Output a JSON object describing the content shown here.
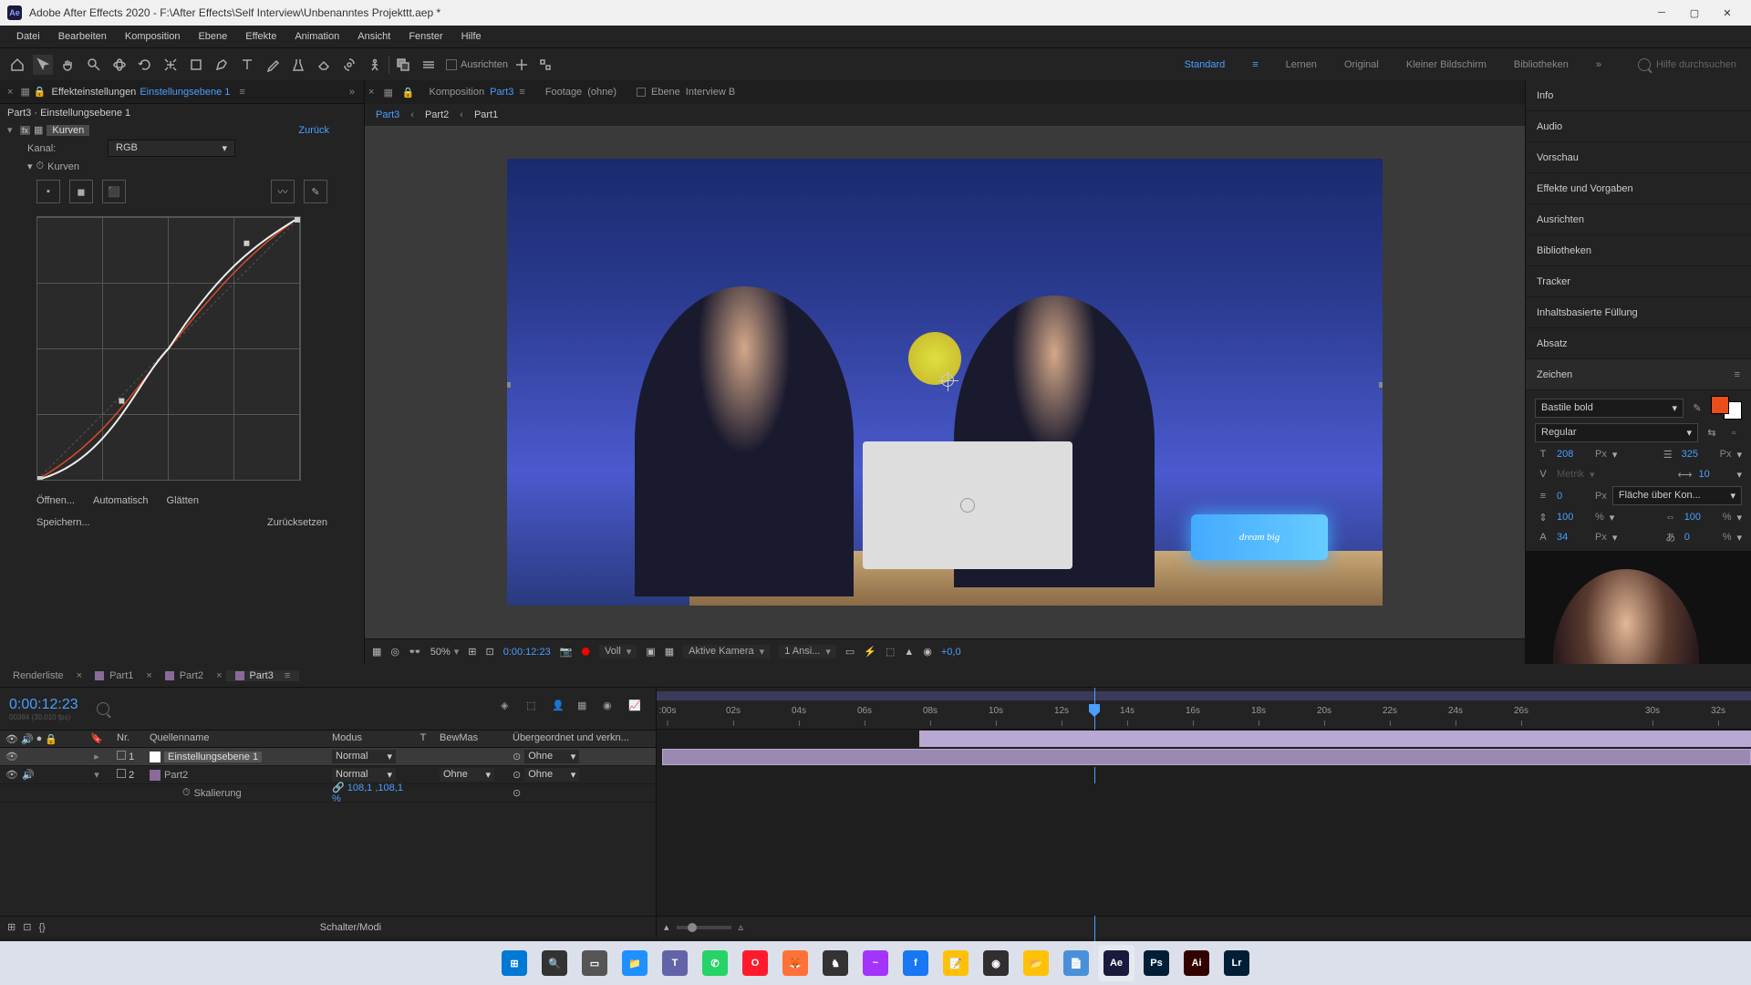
{
  "titlebar": {
    "app_badge": "Ae",
    "title": "Adobe After Effects 2020 - F:\\After Effects\\Self Interview\\Unbenanntes Projekttt.aep *"
  },
  "menu": [
    "Datei",
    "Bearbeiten",
    "Komposition",
    "Ebene",
    "Effekte",
    "Animation",
    "Ansicht",
    "Fenster",
    "Hilfe"
  ],
  "toolbar": {
    "align_label": "Ausrichten",
    "workspaces": [
      "Standard",
      "Lernen",
      "Original",
      "Kleiner Bildschirm",
      "Bibliotheken"
    ],
    "active_workspace": "Standard",
    "search_placeholder": "Hilfe durchsuchen"
  },
  "effect_controls": {
    "tab_label": "Effekteinstellungen",
    "tab_layer": "Einstellungsebene 1",
    "breadcrumb": "Part3 · Einstellungsebene 1",
    "effect_name": "Kurven",
    "reset": "Zurück",
    "channel_label": "Kanal:",
    "channel_value": "RGB",
    "curves_label": "Kurven",
    "btn_open": "Öffnen...",
    "btn_auto": "Automatisch",
    "btn_smooth": "Glätten",
    "btn_save": "Speichern...",
    "btn_reset2": "Zurücksetzen"
  },
  "composition": {
    "tab_comp": "Komposition",
    "comp_name": "Part3",
    "tab_footage": "Footage",
    "footage_val": "(ohne)",
    "tab_layer": "Ebene",
    "layer_val": "Interview B",
    "crumbs": [
      "Part3",
      "Part2",
      "Part1"
    ],
    "neon_text": "dream big"
  },
  "viewer_footer": {
    "zoom": "50%",
    "timecode": "0:00:12:23",
    "resolution": "Voll",
    "camera": "Aktive Kamera",
    "views": "1 Ansi...",
    "exposure": "+0,0"
  },
  "right_panels": {
    "info": "Info",
    "audio": "Audio",
    "preview": "Vorschau",
    "effects": "Effekte und Vorgaben",
    "align": "Ausrichten",
    "libraries": "Bibliotheken",
    "tracker": "Tracker",
    "content_fill": "Inhaltsbasierte Füllung",
    "paragraph": "Absatz",
    "character": "Zeichen"
  },
  "character": {
    "font": "Bastile bold",
    "style": "Regular",
    "size": "208",
    "size_unit": "Px",
    "leading": "325",
    "leading_unit": "Px",
    "kerning": "Metrik",
    "tracking": "10",
    "stroke_w": "0",
    "stroke_unit": "Px",
    "fill_label": "Fläche über Kon...",
    "vscale": "100",
    "vscale_unit": "%",
    "hscale": "100",
    "hscale_unit": "%",
    "baseline": "34",
    "baseline_unit": "Px",
    "tsume": "0",
    "tsume_unit": "%"
  },
  "timeline": {
    "tabs": [
      {
        "label": "Renderliste",
        "icon": false
      },
      {
        "label": "Part1",
        "icon": true
      },
      {
        "label": "Part2",
        "icon": true
      },
      {
        "label": "Part3",
        "icon": true,
        "active": true
      }
    ],
    "timecode": "0:00:12:23",
    "timecode_sub": "00384 (30.010 fps)",
    "columns": {
      "nr": "Nr.",
      "source": "Quellenname",
      "mode": "Modus",
      "t": "T",
      "trkmat": "BewMas",
      "parent": "Übergeordnet und verkn..."
    },
    "layers": [
      {
        "nr": "1",
        "name": "Einstellungsebene 1",
        "mode": "Normal",
        "track": "",
        "parent": "Ohne",
        "selected": true,
        "icon": "solid"
      },
      {
        "nr": "2",
        "name": "Part2",
        "mode": "Normal",
        "track": "Ohne",
        "parent": "Ohne",
        "selected": false,
        "icon": "comp"
      }
    ],
    "scale_prop": "Skalierung",
    "scale_val": "108,1 ,108,1 %",
    "ruler_ticks": [
      ":00s",
      "02s",
      "04s",
      "06s",
      "08s",
      "10s",
      "12s",
      "14s",
      "16s",
      "18s",
      "20s",
      "22s",
      "24s",
      "26s",
      "30s",
      "32s"
    ],
    "footer_mode": "Schalter/Modi"
  },
  "taskbar_icons": [
    {
      "name": "windows",
      "bg": "#0078d4",
      "txt": "⊞"
    },
    {
      "name": "search",
      "bg": "#333",
      "txt": "🔍"
    },
    {
      "name": "taskview",
      "bg": "#555",
      "txt": "▭"
    },
    {
      "name": "explorer",
      "bg": "#1e90ff",
      "txt": "📁"
    },
    {
      "name": "teams",
      "bg": "#6264a7",
      "txt": "T"
    },
    {
      "name": "whatsapp",
      "bg": "#25d366",
      "txt": "✆"
    },
    {
      "name": "opera",
      "bg": "#ff1b2d",
      "txt": "O"
    },
    {
      "name": "firefox",
      "bg": "#ff7139",
      "txt": "🦊"
    },
    {
      "name": "app1",
      "bg": "#333",
      "txt": "♞"
    },
    {
      "name": "messenger",
      "bg": "#a334fa",
      "txt": "~"
    },
    {
      "name": "facebook",
      "bg": "#1877f2",
      "txt": "f"
    },
    {
      "name": "notes",
      "bg": "#ffc107",
      "txt": "📝"
    },
    {
      "name": "obs",
      "bg": "#302e31",
      "txt": "◉"
    },
    {
      "name": "files",
      "bg": "#ffc107",
      "txt": "📂"
    },
    {
      "name": "notepad",
      "bg": "#4a90d9",
      "txt": "📄"
    },
    {
      "name": "ae",
      "bg": "#1a1a3e",
      "txt": "Ae"
    },
    {
      "name": "ps",
      "bg": "#001e36",
      "txt": "Ps"
    },
    {
      "name": "ai",
      "bg": "#330000",
      "txt": "Ai"
    },
    {
      "name": "lr",
      "bg": "#001e36",
      "txt": "Lr"
    }
  ]
}
